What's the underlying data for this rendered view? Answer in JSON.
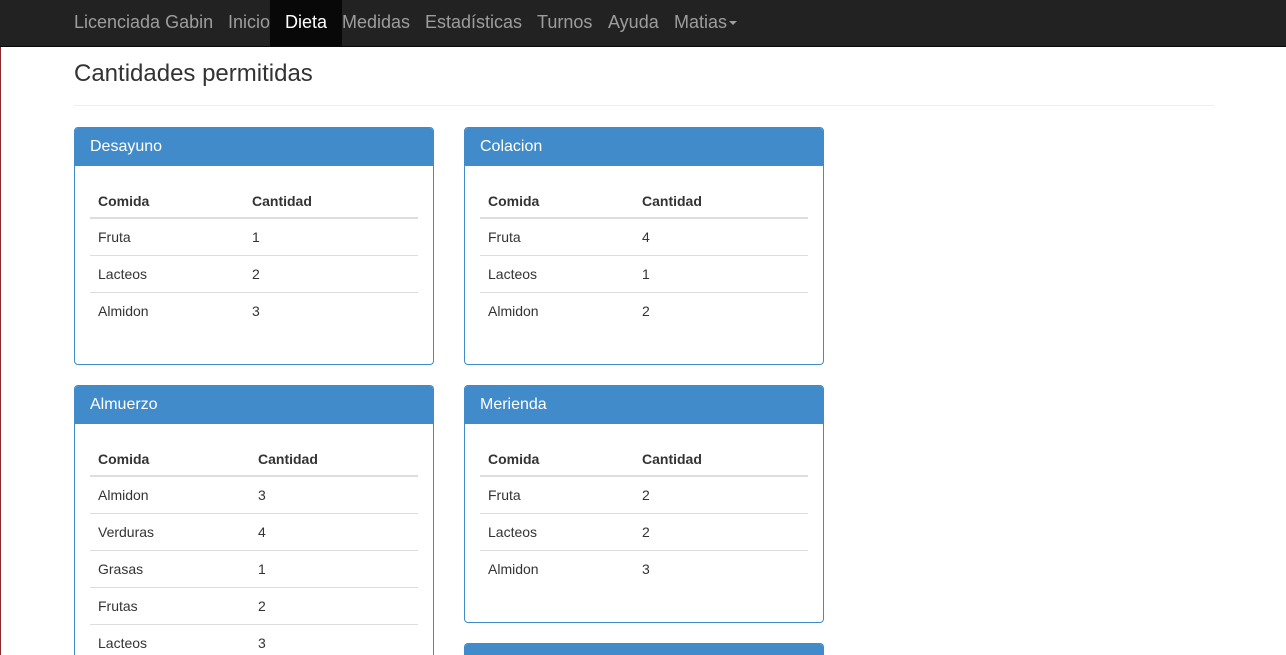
{
  "nav": {
    "brand": "Licenciada Gabin",
    "items": [
      "Inicio",
      "Dieta",
      "Medidas",
      "Estadísticas",
      "Turnos",
      "Ayuda"
    ],
    "active": "Dieta",
    "user": "Matias"
  },
  "page": {
    "title": "Cantidades permitidas"
  },
  "panels": [
    {
      "title": "Desayuno",
      "headers": [
        "Comida",
        "Cantidad"
      ],
      "rows": [
        [
          "Fruta",
          "1"
        ],
        [
          "Lacteos",
          "2"
        ],
        [
          "Almidon",
          "3"
        ]
      ]
    },
    {
      "title": "Colacion",
      "headers": [
        "Comida",
        "Cantidad"
      ],
      "rows": [
        [
          "Fruta",
          "4"
        ],
        [
          "Lacteos",
          "1"
        ],
        [
          "Almidon",
          "2"
        ]
      ]
    },
    {
      "title": "Almuerzo",
      "headers": [
        "Comida",
        "Cantidad"
      ],
      "rows": [
        [
          "Almidon",
          "3"
        ],
        [
          "Verduras",
          "4"
        ],
        [
          "Grasas",
          "1"
        ],
        [
          "Frutas",
          "2"
        ],
        [
          "Lacteos",
          "3"
        ]
      ]
    },
    {
      "title": "Merienda",
      "headers": [
        "Comida",
        "Cantidad"
      ],
      "rows": [
        [
          "Fruta",
          "2"
        ],
        [
          "Lacteos",
          "2"
        ],
        [
          "Almidon",
          "3"
        ]
      ]
    },
    {
      "title": "",
      "headers": [],
      "rows": []
    }
  ],
  "colors": {
    "navbar": "#222222",
    "nav_active": "#080808",
    "panel_primary": "#428bca"
  }
}
